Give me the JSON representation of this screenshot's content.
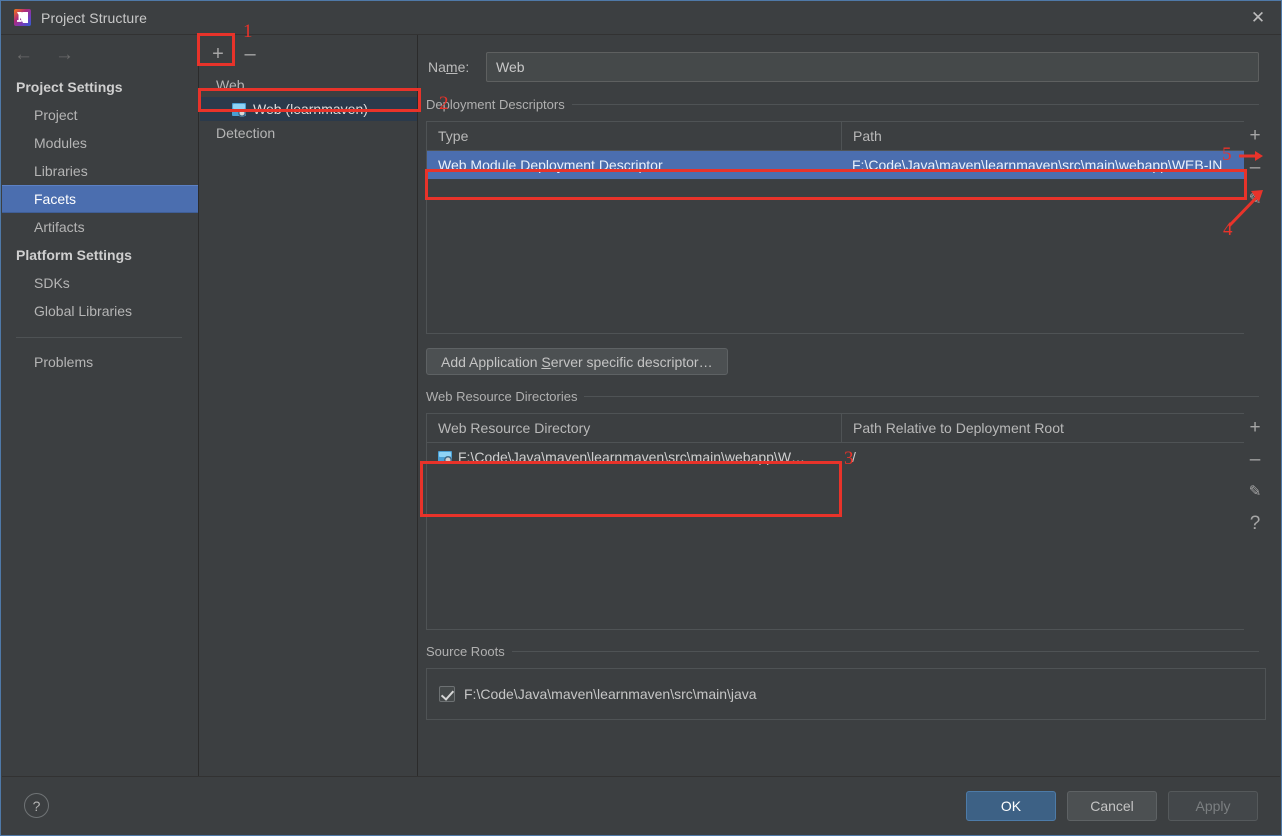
{
  "window": {
    "title": "Project Structure",
    "app_icon": "intellij-idea-icon",
    "close_label": "✕"
  },
  "nav": {
    "back_icon": "←",
    "forward_icon": "→",
    "groups": [
      {
        "label": "Project Settings",
        "items": [
          {
            "label": "Project",
            "selected": false
          },
          {
            "label": "Modules",
            "selected": false
          },
          {
            "label": "Libraries",
            "selected": false
          },
          {
            "label": "Facets",
            "selected": true
          },
          {
            "label": "Artifacts",
            "selected": false
          }
        ]
      },
      {
        "label": "Platform Settings",
        "items": [
          {
            "label": "SDKs",
            "selected": false
          },
          {
            "label": "Global Libraries",
            "selected": false
          }
        ]
      }
    ],
    "extra_item": {
      "label": "Problems",
      "selected": false
    }
  },
  "facets": {
    "toolbar": {
      "add_label": "+",
      "remove_label": "–"
    },
    "root_label": "Web",
    "child_label": "Web (learnmaven)",
    "detection_label": "Detection"
  },
  "main": {
    "name_label_pre": "Na",
    "name_label_mnemonic": "m",
    "name_label_post": "e:",
    "name_value": "Web",
    "name_placeholder": "Name",
    "deployment": {
      "group_title": "Deployment Descriptors",
      "columns": [
        "Type",
        "Path"
      ],
      "rows": [
        {
          "type": "Web Module Deployment Descriptor",
          "path": "F:\\Code\\Java\\maven\\learnmaven\\src\\main\\webapp\\WEB-IN",
          "selected": true
        }
      ],
      "side_buttons": [
        {
          "name": "add-descriptor-button",
          "glyph": "+"
        },
        {
          "name": "remove-descriptor-button",
          "glyph": "–"
        },
        {
          "name": "edit-descriptor-button",
          "glyph": "✎"
        }
      ],
      "add_server_descriptor_pre": "Add Application ",
      "add_server_descriptor_mnemonic": "S",
      "add_server_descriptor_post": "erver specific descriptor…"
    },
    "web_resources": {
      "group_title": "Web Resource Directories",
      "columns": [
        "Web Resource Directory",
        "Path Relative to Deployment Root"
      ],
      "rows": [
        {
          "directory": "F:\\Code\\Java\\maven\\learnmaven\\src\\main\\webapp\\W…",
          "relative_path": "/"
        }
      ],
      "side_buttons": [
        {
          "name": "add-resource-dir-button",
          "glyph": "+"
        },
        {
          "name": "remove-resource-dir-button",
          "glyph": "–"
        },
        {
          "name": "edit-resource-dir-button",
          "glyph": "✎"
        },
        {
          "name": "help-resource-dir-button",
          "glyph": "?"
        }
      ]
    },
    "source_roots": {
      "group_title": "Source Roots",
      "entries": [
        {
          "checked": true,
          "path": "F:\\Code\\Java\\maven\\learnmaven\\src\\main\\java"
        }
      ]
    }
  },
  "footer": {
    "help_label": "?",
    "ok_label": "OK",
    "cancel_label": "Cancel",
    "apply_label": "Apply"
  },
  "annotations": {
    "color": "#e8332a",
    "markers": [
      {
        "id": "1",
        "label": "1",
        "target": "facets-add-button"
      },
      {
        "id": "2",
        "label": "2",
        "target": "deployment-descriptors-group"
      },
      {
        "id": "3",
        "label": "3",
        "target": "web-resource-directory-column"
      },
      {
        "id": "4",
        "label": "4",
        "target": "remove-descriptor-button"
      },
      {
        "id": "5",
        "label": "5",
        "target": "add-descriptor-button"
      }
    ]
  }
}
